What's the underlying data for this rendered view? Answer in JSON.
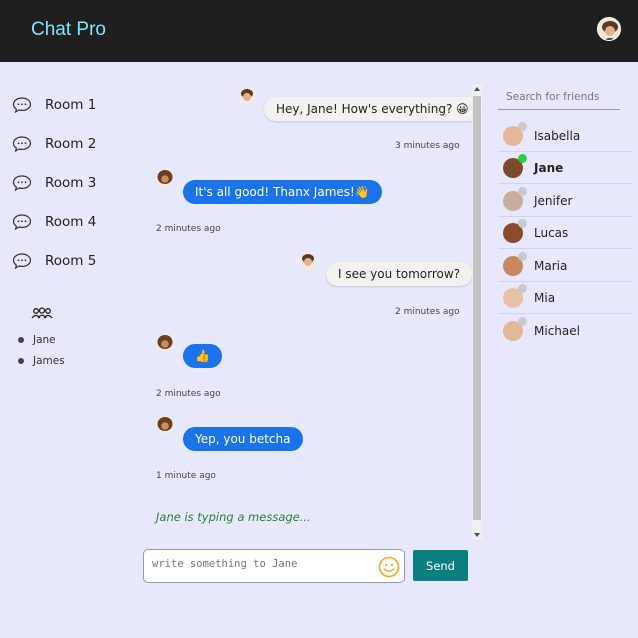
{
  "app": {
    "title": "Chat Pro"
  },
  "rooms": [
    {
      "label": "Room 1"
    },
    {
      "label": "Room 2"
    },
    {
      "label": "Room 3"
    },
    {
      "label": "Room 4"
    },
    {
      "label": "Room 5"
    }
  ],
  "online_users": [
    {
      "name": "Jane"
    },
    {
      "name": "James"
    }
  ],
  "messages": [
    {
      "text": "Hey, Jane! How's everything? 😀",
      "direction": "out",
      "time": "3 minutes ago"
    },
    {
      "text": "It's all good! Thanx James!👋",
      "direction": "in",
      "time": "2 minutes ago"
    },
    {
      "text": "I see you tomorrow?",
      "direction": "out",
      "time": "2 minutes ago"
    },
    {
      "text": "👍",
      "direction": "in",
      "time": "2 minutes ago"
    },
    {
      "text": "Yep, you betcha",
      "direction": "in",
      "time": "1 minute ago"
    }
  ],
  "typing_indicator": "Jane is typing a message...",
  "composer": {
    "placeholder": "write something to Jane",
    "send_label": "Send"
  },
  "friends": {
    "search_placeholder": "Search for friends",
    "list": [
      {
        "name": "Isabella",
        "status": "offline"
      },
      {
        "name": "Jane",
        "status": "online",
        "active": true
      },
      {
        "name": "Jenifer",
        "status": "offline"
      },
      {
        "name": "Lucas",
        "status": "offline"
      },
      {
        "name": "Maria",
        "status": "offline"
      },
      {
        "name": "Mia",
        "status": "offline"
      },
      {
        "name": "Michael",
        "status": "offline"
      }
    ]
  },
  "colors": {
    "topbar": "#1f1f1f",
    "brand": "#7fe7ff",
    "background": "#e8e8fd",
    "incoming_bubble": "#1a73e8",
    "send_button": "#0b7f7f",
    "online_status": "#2ecc40",
    "typing_text": "#2e7d32"
  }
}
